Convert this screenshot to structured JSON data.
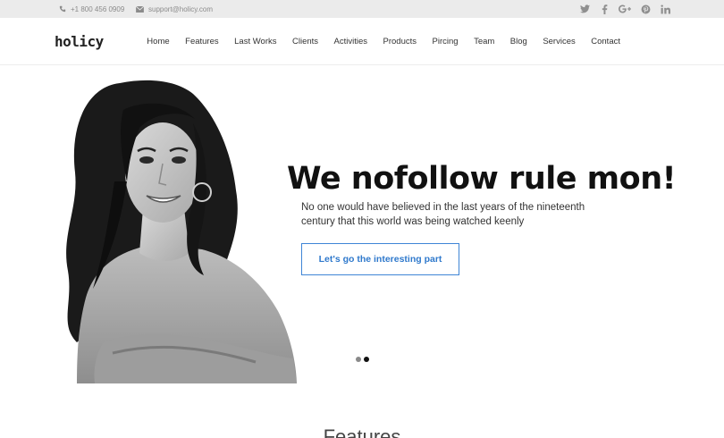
{
  "topbar": {
    "phone": "+1 800 456 0909",
    "email": "support@holicy.com",
    "social": [
      {
        "icon": "twitter-icon",
        "glyph": "t"
      },
      {
        "icon": "facebook-icon",
        "glyph": "f"
      },
      {
        "icon": "google-plus-icon",
        "glyph": "g+"
      },
      {
        "icon": "pinterest-icon",
        "glyph": "p"
      },
      {
        "icon": "linkedin-icon",
        "glyph": "in"
      }
    ]
  },
  "header": {
    "logo": "holicy",
    "nav": [
      "Home",
      "Features",
      "Last Works",
      "Clients",
      "Activities",
      "Products",
      "Pircing",
      "Team",
      "Blog",
      "Services",
      "Contact"
    ]
  },
  "hero": {
    "headline": "We nofollow rule mon!",
    "subtext": "No one would have believed in the last years of the nineteenth century that this world was being watched keenly",
    "cta": "Let's go the interesting part",
    "slides": 2,
    "active_slide": 2
  },
  "features": {
    "title": "Features"
  },
  "colors": {
    "accent": "#3f85d6",
    "topbar_bg": "#ebebeb"
  }
}
